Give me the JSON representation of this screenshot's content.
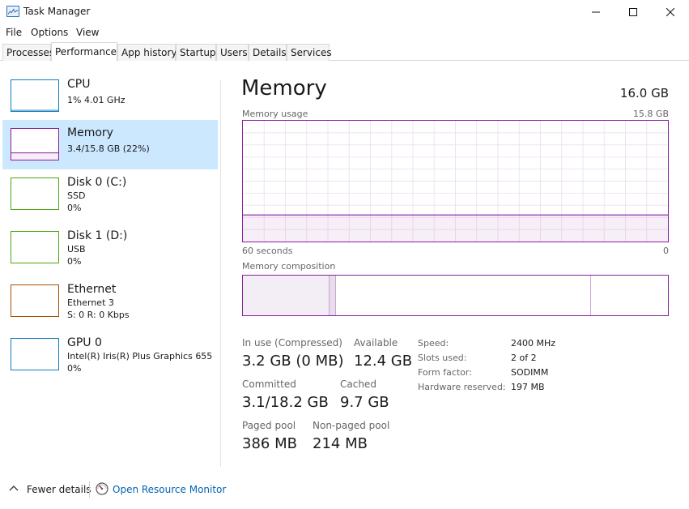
{
  "window": {
    "title": "Task Manager",
    "icon": "task-manager-icon"
  },
  "menu": [
    "File",
    "Options",
    "View"
  ],
  "tabs": [
    "Processes",
    "Performance",
    "App history",
    "Startup",
    "Users",
    "Details",
    "Services"
  ],
  "active_tab": "Performance",
  "sidebar": [
    {
      "title": "CPU",
      "line1": "1%  4.01 GHz",
      "line2": "",
      "color": "#117dbb",
      "percent": 1
    },
    {
      "title": "Memory",
      "line1": "3.4/15.8 GB (22%)",
      "line2": "",
      "color": "#8b1ea0",
      "percent": 22,
      "selected": true
    },
    {
      "title": "Disk 0 (C:)",
      "line1": "SSD",
      "line2": "0%",
      "color": "#4da60c",
      "percent": 0
    },
    {
      "title": "Disk 1 (D:)",
      "line1": "USB",
      "line2": "0%",
      "color": "#4da60c",
      "percent": 0
    },
    {
      "title": "Ethernet",
      "line1": "Ethernet 3",
      "line2": "S: 0  R: 0 Kbps",
      "color": "#a74f01",
      "percent": 0
    },
    {
      "title": "GPU 0",
      "line1": "Intel(R) Iris(R) Plus Graphics 655",
      "line2": "0%",
      "color": "#117dbb",
      "percent": 0
    }
  ],
  "main": {
    "title": "Memory",
    "total": "16.0 GB",
    "usage_label": "Memory usage",
    "usage_max": "15.8 GB",
    "time_label": "60 seconds",
    "time_end": "0",
    "usage_fraction": 0.22,
    "composition_label": "Memory composition",
    "composition": {
      "in_use": 0.203,
      "modified": 0.016,
      "standby": 0.6,
      "free": 0.181
    },
    "stats": {
      "in_use_label": "In use (Compressed)",
      "in_use_value": "3.2 GB (0 MB)",
      "available_label": "Available",
      "available_value": "12.4 GB",
      "committed_label": "Committed",
      "committed_value": "3.1/18.2 GB",
      "cached_label": "Cached",
      "cached_value": "9.7 GB",
      "paged_label": "Paged pool",
      "paged_value": "386 MB",
      "nonpaged_label": "Non-paged pool",
      "nonpaged_value": "214 MB"
    },
    "details": [
      {
        "label": "Speed:",
        "value": "2400 MHz"
      },
      {
        "label": "Slots used:",
        "value": "2 of 2"
      },
      {
        "label": "Form factor:",
        "value": "SODIMM"
      },
      {
        "label": "Hardware reserved:",
        "value": "197 MB"
      }
    ]
  },
  "footer": {
    "fewer_details": "Fewer details",
    "resource_monitor": "Open Resource Monitor"
  }
}
